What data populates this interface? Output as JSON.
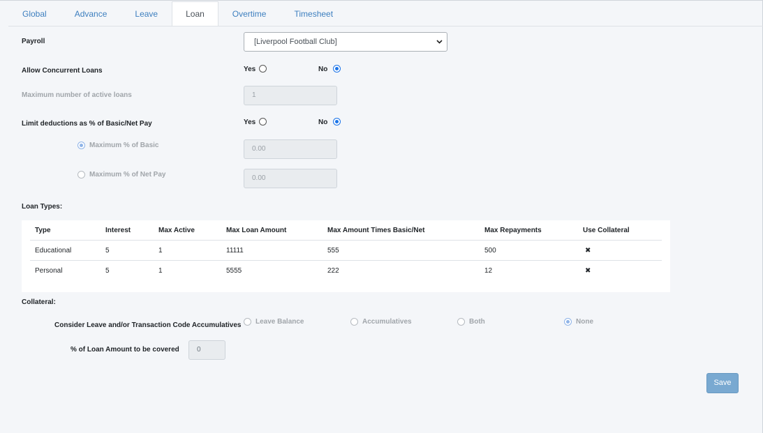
{
  "tabs": [
    {
      "label": "Global"
    },
    {
      "label": "Advance"
    },
    {
      "label": "Leave"
    },
    {
      "label": "Loan"
    },
    {
      "label": "Overtime"
    },
    {
      "label": "Timesheet"
    }
  ],
  "active_tab": "Loan",
  "payroll": {
    "label": "Payroll",
    "selected": "[Liverpool Football Club]"
  },
  "concurrent": {
    "label": "Allow Concurrent Loans",
    "yes": "Yes",
    "no": "No",
    "value": "No"
  },
  "max_active": {
    "label": "Maximum number of active loans",
    "value": "1"
  },
  "limit": {
    "label": "Limit deductions as % of Basic/Net Pay",
    "yes": "Yes",
    "no": "No",
    "value": "No"
  },
  "max_basic": {
    "label": "Maximum % of Basic",
    "value": "0.00"
  },
  "max_net": {
    "label": "Maximum % of Net Pay",
    "value": "0.00"
  },
  "loan_types": {
    "title": "Loan Types:",
    "columns": [
      "Type",
      "Interest",
      "Max Active",
      "Max Loan Amount",
      "Max Amount Times Basic/Net",
      "Max Repayments",
      "Use Collateral"
    ],
    "rows": [
      [
        "Educational",
        "5",
        "1",
        "11111",
        "555",
        "500",
        "✖"
      ],
      [
        "Personal",
        "5",
        "1",
        "5555",
        "222",
        "12",
        "✖"
      ]
    ]
  },
  "collateral": {
    "title": "Collateral:",
    "consider_label": "Consider Leave and/or Transaction Code Accumulatives",
    "options": [
      "Leave Balance",
      "Accumulatives",
      "Both",
      "None"
    ],
    "selected": "None",
    "pct_label": "% of Loan Amount to be covered",
    "pct_value": "0"
  },
  "save_label": "Save",
  "colors": {
    "accent": "#3d7fbf",
    "radio": "#1a73e8",
    "save": "#79a9d1"
  }
}
